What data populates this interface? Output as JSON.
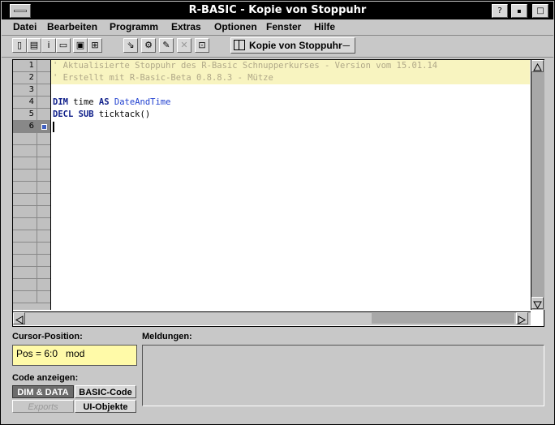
{
  "window": {
    "title": "R-BASIC - Kopie von Stoppuhr",
    "help_label": "?",
    "minimize_label": "▪",
    "maximize_label": "□"
  },
  "menu": [
    {
      "label": "Datei"
    },
    {
      "label": "Bearbeiten"
    },
    {
      "label": "Programm"
    },
    {
      "label": "Extras"
    },
    {
      "label": "Optionen"
    },
    {
      "label": "Fenster"
    },
    {
      "label": "Hilfe"
    }
  ],
  "toolbar": {
    "icons": [
      "new-icon",
      "open-icon",
      "info-icon",
      "folder-icon",
      "save-icon",
      "compile-icon",
      "trace-icon",
      "run-icon",
      "debug-icon",
      "stop-icon",
      "window-icon"
    ],
    "document_selector": "Kopie von Stoppuhr",
    "document_arrow": "─"
  },
  "editor": {
    "line_numbers": [
      "1",
      "2",
      "3",
      "4",
      "5",
      "6"
    ],
    "current_line": 6,
    "lines": [
      {
        "text": "' Aktualisierte Stoppuhr des R-Basic Schnupperkurses - Version vom 15.01.14"
      },
      {
        "text": "' Erstellt mit R-Basic-Beta 0.8.8.3 - Mütze"
      },
      {
        "text": ""
      },
      {
        "kw1": "DIM",
        "ident": "time",
        "kw2": "AS",
        "type": "DateAndTime"
      },
      {
        "kw1": "DECL",
        "kw2": "SUB",
        "ident": "ticktack()"
      },
      {
        "text": ""
      }
    ]
  },
  "colors": {
    "comment_bg": "#f8f4c0",
    "comment_fg": "#b0a888",
    "keyword": "#10208a",
    "type": "#2040d0",
    "cursor_box": "#fffaa8"
  },
  "status": {
    "cursor_label": "Cursor-Position:",
    "cursor_value": "Pos = 6:0   mod",
    "messages_label": "Meldungen:"
  },
  "code_view": {
    "label": "Code anzeigen:",
    "buttons": [
      {
        "label": "DIM & DATA",
        "state": "selected"
      },
      {
        "label": "BASIC-Code",
        "state": "normal"
      },
      {
        "label": "Exports",
        "state": "disabled"
      },
      {
        "label": "UI-Objekte",
        "state": "normal"
      }
    ]
  }
}
